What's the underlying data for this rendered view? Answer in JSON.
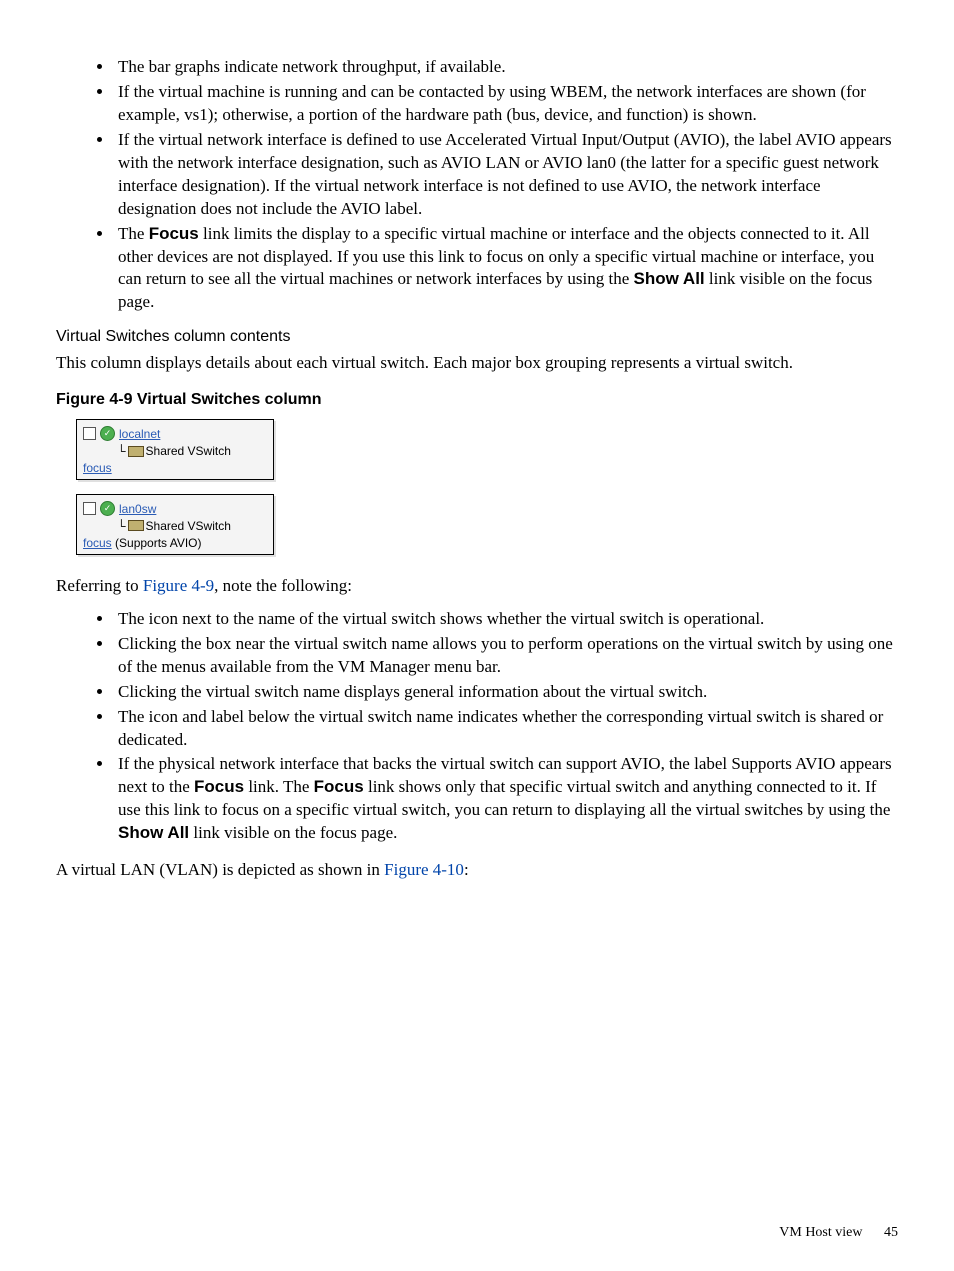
{
  "lists": {
    "top": [
      "The bar graphs indicate network throughput, if available.",
      "If the virtual machine is running and can be contacted by using WBEM, the network interfaces are shown (for example, vs1); otherwise, a portion of the hardware path (bus, device, and function) is shown.",
      "If the virtual network interface is defined to use Accelerated Virtual Input/Output (AVIO), the label AVIO appears with the network interface designation, such as AVIO LAN or AVIO lan0 (the latter for a specific guest network interface designation). If the virtual network interface is not defined to use AVIO, the network interface designation does not include the AVIO label."
    ],
    "top_focus_pre": "The ",
    "top_focus_b1": "Focus",
    "top_focus_mid": " link limits the display to a specific virtual machine or interface and the objects connected to it. All other devices are not displayed. If you use this link to focus on only a specific virtual machine or interface, you can return to see all the virtual machines or network interfaces by using the ",
    "top_focus_b2": "Show All",
    "top_focus_post": " link visible on the focus page.",
    "bottom": [
      "The icon next to the name of the virtual switch shows whether the virtual switch is operational.",
      "Clicking the box near the virtual switch name allows you to perform operations on the virtual switch by using one of the menus available from the VM Manager menu bar.",
      "Clicking the virtual switch name displays general information about the virtual switch.",
      "The icon and label below the virtual switch name indicates whether the corresponding virtual switch is shared or dedicated."
    ],
    "bottom_focus_pre": "If the physical network interface that backs the virtual switch can support AVIO, the label Supports AVIO appears next to the ",
    "bottom_focus_b1": "Focus",
    "bottom_focus_mid1": " link. The ",
    "bottom_focus_b2": "Focus",
    "bottom_focus_mid2": " link shows only that specific virtual switch and anything connected to it. If use this link to focus on a specific virtual switch, you can return to displaying all the virtual switches by using the ",
    "bottom_focus_b3": "Show All",
    "bottom_focus_post": " link visible on the focus page."
  },
  "subheading": "Virtual Switches column contents",
  "intro_para": "This column displays details about each virtual switch. Each major box grouping represents a virtual switch.",
  "figure_caption": "Figure 4-9 Virtual Switches column",
  "figure": {
    "box1": {
      "name": "localnet",
      "shared": "Shared VSwitch",
      "focus": "focus",
      "suffix": ""
    },
    "box2": {
      "name": "lan0sw",
      "shared": "Shared VSwitch",
      "focus": "focus",
      "suffix": " (Supports AVIO)"
    }
  },
  "ref_para_pre": "Referring to ",
  "ref_para_link": "Figure 4-9",
  "ref_para_post": ", note the following:",
  "vlan_para_pre": "A virtual LAN (VLAN) is depicted as shown in ",
  "vlan_para_link": "Figure 4-10",
  "vlan_para_post": ":",
  "footer": {
    "label": "VM Host view",
    "page": "45"
  }
}
